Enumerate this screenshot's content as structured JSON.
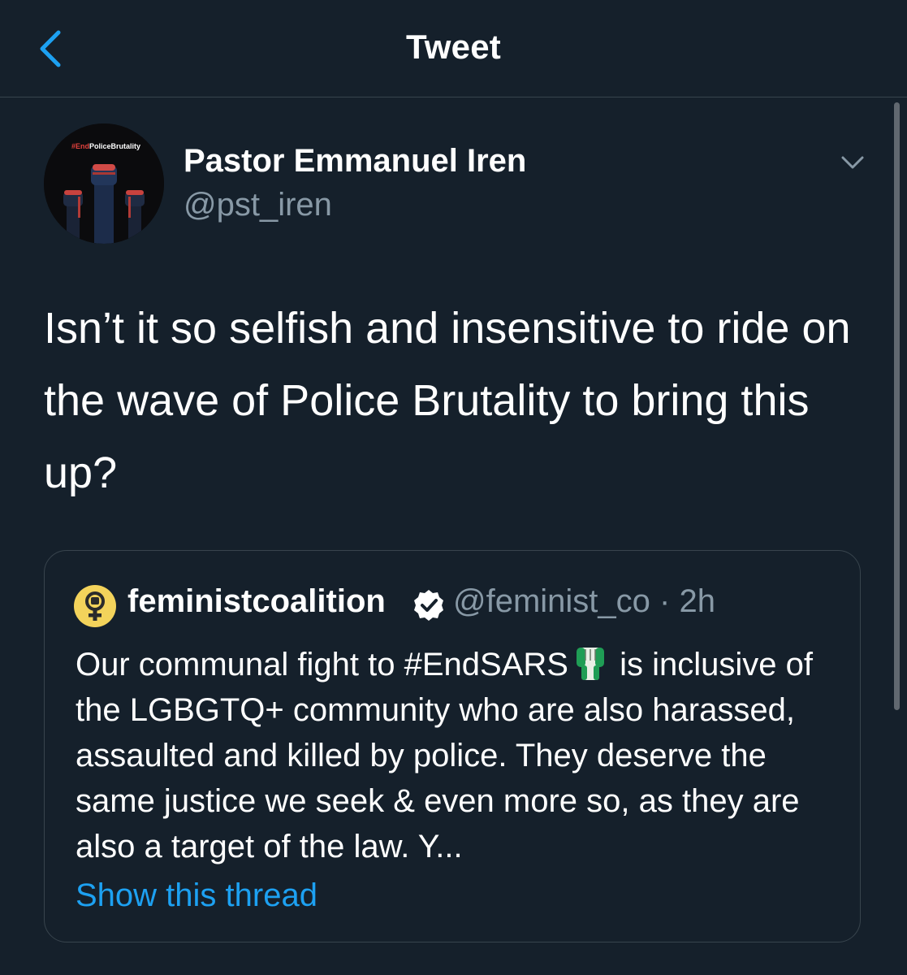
{
  "header": {
    "title": "Tweet",
    "back_icon": "chevron-left-icon"
  },
  "tweet": {
    "author": {
      "display_name": "Pastor Emmanuel Iren",
      "handle": "@pst_iren",
      "avatar_caption_prefix": "#End",
      "avatar_caption_rest": "PoliceBrutality"
    },
    "text": "Isn’t it so selfish and insensitive to ride on the wave of Police Brutality to bring this up?",
    "menu_icon": "chevron-down-icon"
  },
  "quoted_tweet": {
    "author": {
      "display_name": "feministcoalition",
      "handle": "@feminist_co",
      "separator": "·",
      "time": "2h",
      "verified": true
    },
    "text_before_emoji": "Our communal fight to #EndSARS",
    "text_after_emoji": " is inclusive of the LGBGTQ+ community who are also harassed, assaulted and killed by police. They deserve the same justice we seek & even more so, as they are also a target of the law. Y...",
    "show_thread_label": "Show this thread"
  },
  "colors": {
    "background": "#15202b",
    "divider": "#38444d",
    "secondary_text": "#8899a6",
    "accent": "#1da1f2",
    "text": "#ffffff",
    "quote_avatar": "#f3d35b",
    "fist_green": "#1f9d55"
  }
}
